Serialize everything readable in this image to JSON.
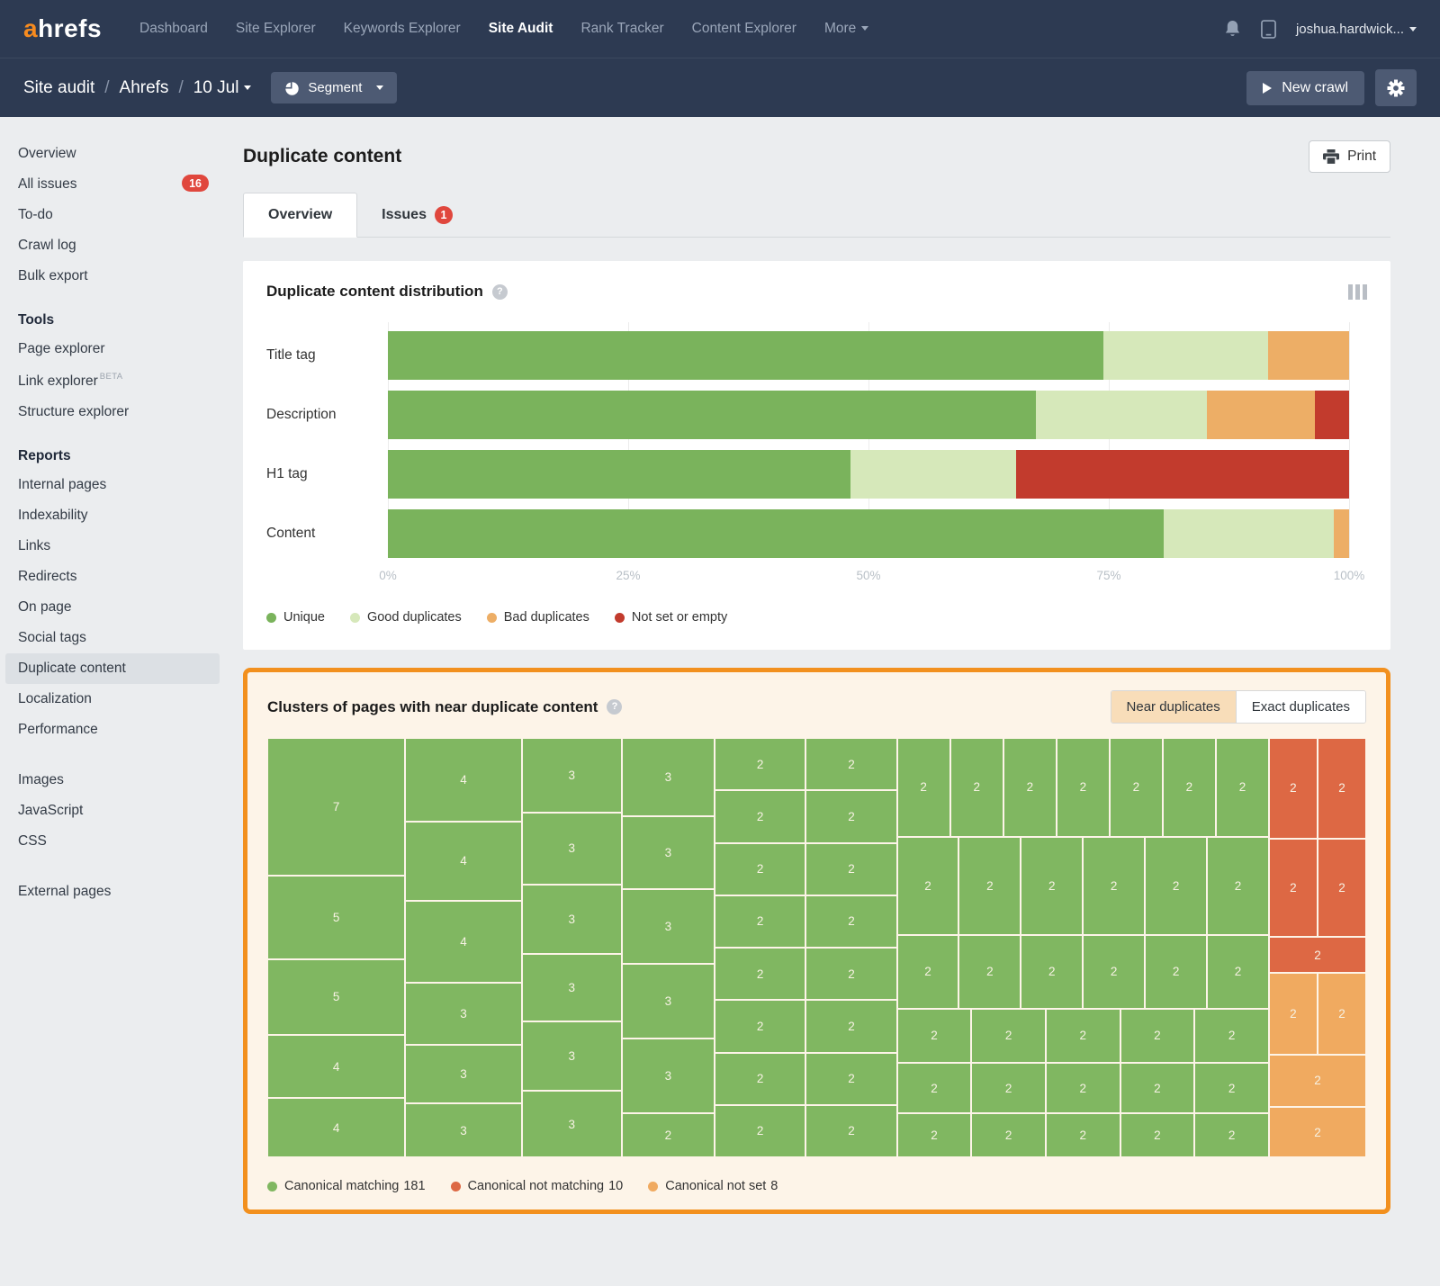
{
  "ui": {
    "help": "?"
  },
  "nav": {
    "logo_a": "a",
    "logo_rest": "hrefs",
    "items": [
      {
        "label": "Dashboard"
      },
      {
        "label": "Site Explorer"
      },
      {
        "label": "Keywords Explorer"
      },
      {
        "label": "Site Audit",
        "active": true
      },
      {
        "label": "Rank Tracker"
      },
      {
        "label": "Content Explorer"
      },
      {
        "label": "More",
        "caret": true
      }
    ],
    "user": "joshua.hardwick..."
  },
  "subnav": {
    "breadcrumb": [
      {
        "label": "Site audit"
      },
      {
        "label": "Ahrefs"
      },
      {
        "label": "10 Jul",
        "caret": true
      }
    ],
    "separator": "/",
    "segment_label": "Segment",
    "new_crawl_label": "New crawl"
  },
  "sidebar": {
    "groups": [
      {
        "heading": null,
        "items": [
          {
            "label": "Overview"
          },
          {
            "label": "All issues",
            "badge": "16"
          },
          {
            "label": "To-do"
          },
          {
            "label": "Crawl log"
          },
          {
            "label": "Bulk export"
          }
        ]
      },
      {
        "heading": "Tools",
        "items": [
          {
            "label": "Page explorer"
          },
          {
            "label": "Link explorer",
            "sup": "BETA"
          },
          {
            "label": "Structure explorer"
          }
        ]
      },
      {
        "heading": "Reports",
        "items": [
          {
            "label": "Internal pages"
          },
          {
            "label": "Indexability"
          },
          {
            "label": "Links"
          },
          {
            "label": "Redirects"
          },
          {
            "label": "On page"
          },
          {
            "label": "Social tags"
          },
          {
            "label": "Duplicate content",
            "selected": true
          },
          {
            "label": "Localization"
          },
          {
            "label": "Performance"
          }
        ]
      },
      {
        "heading": null,
        "gap": true,
        "items": [
          {
            "label": "Images"
          },
          {
            "label": "JavaScript"
          },
          {
            "label": "CSS"
          }
        ]
      },
      {
        "heading": null,
        "gap": true,
        "items": [
          {
            "label": "External pages"
          }
        ]
      }
    ]
  },
  "main": {
    "title": "Duplicate content",
    "print_label": "Print",
    "tabs": [
      {
        "label": "Overview",
        "active": true
      },
      {
        "label": "Issues",
        "badge": "1"
      }
    ]
  },
  "colors": {
    "unique": "#7ab35c",
    "good": "#d6e8ba",
    "bad": "#edae66",
    "notset": "#c23b2d",
    "matching": "#80b761",
    "not_matching": "#dd6844",
    "not_set": "#f0aa60",
    "highlight": "#f2901e",
    "badge": "#e0473d"
  },
  "chart_data": [
    {
      "type": "bar",
      "title": "Duplicate content distribution",
      "orientation": "horizontal",
      "stacked": true,
      "categories": [
        "Title tag",
        "Description",
        "H1 tag",
        "Content"
      ],
      "series": [
        {
          "name": "Unique",
          "color_key": "unique",
          "values": [
            74.4,
            67.4,
            48.1,
            80.7
          ]
        },
        {
          "name": "Good duplicates",
          "color_key": "good",
          "values": [
            17.2,
            17.8,
            17.3,
            17.7
          ]
        },
        {
          "name": "Bad duplicates",
          "color_key": "bad",
          "values": [
            8.4,
            11.2,
            0,
            1.6
          ]
        },
        {
          "name": "Not set or empty",
          "color_key": "notset",
          "values": [
            0,
            3.6,
            34.6,
            0
          ]
        }
      ],
      "xlim": [
        0,
        100
      ],
      "x_ticks": [
        {
          "label": "0%",
          "pos": 0
        },
        {
          "label": "25%",
          "pos": 25
        },
        {
          "label": "50%",
          "pos": 50
        },
        {
          "label": "75%",
          "pos": 75
        },
        {
          "label": "100%",
          "pos": 100
        }
      ],
      "grid": true,
      "legend_position": "bottom"
    },
    {
      "type": "treemap",
      "title": "Clusters of pages with near duplicate content",
      "toggles": [
        {
          "label": "Near duplicates",
          "active": true
        },
        {
          "label": "Exact duplicates",
          "active": false
        }
      ],
      "legend": [
        {
          "label": "Canonical matching",
          "value": 181,
          "color_key": "matching"
        },
        {
          "label": "Canonical not matching",
          "value": 10,
          "color_key": "not_matching"
        },
        {
          "label": "Canonical not set",
          "value": 8,
          "color_key": "not_set"
        }
      ],
      "cell_kinds": [
        "matching",
        "not_matching",
        "not_set"
      ],
      "cells": [
        [
          0,
          0,
          12.55,
          32.8,
          7,
          0
        ],
        [
          0,
          32.8,
          12.55,
          19.9,
          5,
          0
        ],
        [
          0,
          52.7,
          12.55,
          18.2,
          5,
          0
        ],
        [
          0,
          70.9,
          12.55,
          15,
          4,
          0
        ],
        [
          0,
          85.9,
          12.55,
          14.1,
          4,
          0
        ],
        [
          12.55,
          0,
          10.6,
          19.9,
          4,
          0
        ],
        [
          12.55,
          19.9,
          10.6,
          18.9,
          4,
          0
        ],
        [
          12.55,
          38.8,
          10.6,
          19.5,
          4,
          0
        ],
        [
          12.55,
          58.3,
          10.6,
          14.8,
          3,
          0
        ],
        [
          12.55,
          73.1,
          10.6,
          14.1,
          3,
          0
        ],
        [
          12.55,
          87.2,
          10.6,
          12.8,
          3,
          0
        ],
        [
          23.15,
          0,
          9.1,
          17.8,
          3,
          0
        ],
        [
          23.15,
          17.8,
          9.1,
          17.1,
          3,
          0
        ],
        [
          23.15,
          34.9,
          9.1,
          16.5,
          3,
          0
        ],
        [
          23.15,
          51.4,
          9.1,
          16.3,
          3,
          0
        ],
        [
          23.15,
          67.7,
          9.1,
          16.5,
          3,
          0
        ],
        [
          23.15,
          84.2,
          9.1,
          15.8,
          3,
          0
        ],
        [
          32.25,
          0,
          8.45,
          18.6,
          3,
          0
        ],
        [
          32.25,
          18.6,
          8.45,
          17.4,
          3,
          0
        ],
        [
          32.25,
          36,
          8.45,
          17.8,
          3,
          0
        ],
        [
          32.25,
          53.8,
          8.45,
          17.8,
          3,
          0
        ],
        [
          32.25,
          71.6,
          8.45,
          17.8,
          3,
          0
        ],
        [
          32.25,
          89.4,
          8.45,
          10.6,
          2,
          0
        ],
        [
          40.7,
          0,
          8.3,
          12.5,
          2,
          0
        ],
        [
          40.7,
          12.5,
          8.3,
          12.5,
          2,
          0
        ],
        [
          40.7,
          25,
          8.3,
          12.5,
          2,
          0
        ],
        [
          40.7,
          37.5,
          8.3,
          12.5,
          2,
          0
        ],
        [
          40.7,
          50,
          8.3,
          12.5,
          2,
          0
        ],
        [
          40.7,
          62.5,
          8.3,
          12.5,
          2,
          0
        ],
        [
          40.7,
          75,
          8.3,
          12.5,
          2,
          0
        ],
        [
          40.7,
          87.5,
          8.3,
          12.5,
          2,
          0
        ],
        [
          49,
          0,
          8.3,
          12.5,
          2,
          0
        ],
        [
          49,
          12.5,
          8.3,
          12.5,
          2,
          0
        ],
        [
          49,
          25,
          8.3,
          12.5,
          2,
          0
        ],
        [
          49,
          37.5,
          8.3,
          12.5,
          2,
          0
        ],
        [
          49,
          50,
          8.3,
          12.5,
          2,
          0
        ],
        [
          49,
          62.5,
          8.3,
          12.5,
          2,
          0
        ],
        [
          49,
          75,
          8.3,
          12.5,
          2,
          0
        ],
        [
          49,
          87.5,
          8.3,
          12.5,
          2,
          0
        ],
        [
          57.3,
          0,
          4.84,
          23.5,
          2,
          0
        ],
        [
          62.14,
          0,
          4.84,
          23.5,
          2,
          0
        ],
        [
          66.98,
          0,
          4.84,
          23.5,
          2,
          0
        ],
        [
          71.81,
          0,
          4.84,
          23.5,
          2,
          0
        ],
        [
          76.65,
          0,
          4.84,
          23.5,
          2,
          0
        ],
        [
          81.48,
          0,
          4.84,
          23.5,
          2,
          0
        ],
        [
          86.32,
          0,
          4.84,
          23.5,
          2,
          0
        ],
        [
          57.3,
          23.5,
          5.64,
          23.5,
          2,
          0
        ],
        [
          62.94,
          23.5,
          5.64,
          23.5,
          2,
          0
        ],
        [
          68.58,
          23.5,
          5.64,
          23.5,
          2,
          0
        ],
        [
          74.22,
          23.5,
          5.64,
          23.5,
          2,
          0
        ],
        [
          79.87,
          23.5,
          5.64,
          23.5,
          2,
          0
        ],
        [
          85.51,
          23.5,
          5.64,
          23.5,
          2,
          0
        ],
        [
          57.3,
          47,
          5.64,
          17.5,
          2,
          0
        ],
        [
          62.94,
          47,
          5.64,
          17.5,
          2,
          0
        ],
        [
          68.58,
          47,
          5.64,
          17.5,
          2,
          0
        ],
        [
          74.22,
          47,
          5.64,
          17.5,
          2,
          0
        ],
        [
          79.87,
          47,
          5.64,
          17.5,
          2,
          0
        ],
        [
          85.51,
          47,
          5.64,
          17.5,
          2,
          0
        ],
        [
          57.3,
          64.5,
          6.77,
          13,
          2,
          0
        ],
        [
          64.07,
          64.5,
          6.77,
          13,
          2,
          0
        ],
        [
          70.84,
          64.5,
          6.77,
          13,
          2,
          0
        ],
        [
          77.61,
          64.5,
          6.77,
          13,
          2,
          0
        ],
        [
          84.38,
          64.5,
          6.77,
          13,
          2,
          0
        ],
        [
          57.3,
          77.5,
          6.77,
          12,
          2,
          0
        ],
        [
          64.07,
          77.5,
          6.77,
          12,
          2,
          0
        ],
        [
          70.84,
          77.5,
          6.77,
          12,
          2,
          0
        ],
        [
          77.61,
          77.5,
          6.77,
          12,
          2,
          0
        ],
        [
          84.38,
          77.5,
          6.77,
          12,
          2,
          0
        ],
        [
          57.3,
          89.5,
          6.77,
          10.5,
          2,
          0
        ],
        [
          64.07,
          89.5,
          6.77,
          10.5,
          2,
          0
        ],
        [
          70.84,
          89.5,
          6.77,
          10.5,
          2,
          0
        ],
        [
          77.61,
          89.5,
          6.77,
          10.5,
          2,
          0
        ],
        [
          84.38,
          89.5,
          6.77,
          10.5,
          2,
          0
        ],
        [
          91.15,
          0,
          4.42,
          24,
          2,
          1
        ],
        [
          95.57,
          0,
          4.43,
          24,
          2,
          1
        ],
        [
          91.15,
          24,
          4.42,
          23.5,
          2,
          1
        ],
        [
          95.57,
          24,
          4.43,
          23.5,
          2,
          1
        ],
        [
          91.15,
          47.5,
          8.85,
          8.5,
          2,
          1
        ],
        [
          91.15,
          56,
          4.42,
          19.5,
          2,
          2
        ],
        [
          95.57,
          56,
          4.43,
          19.5,
          2,
          2
        ],
        [
          91.15,
          75.5,
          8.85,
          12.5,
          2,
          2
        ],
        [
          91.15,
          88,
          8.85,
          12,
          2,
          2
        ]
      ]
    }
  ]
}
